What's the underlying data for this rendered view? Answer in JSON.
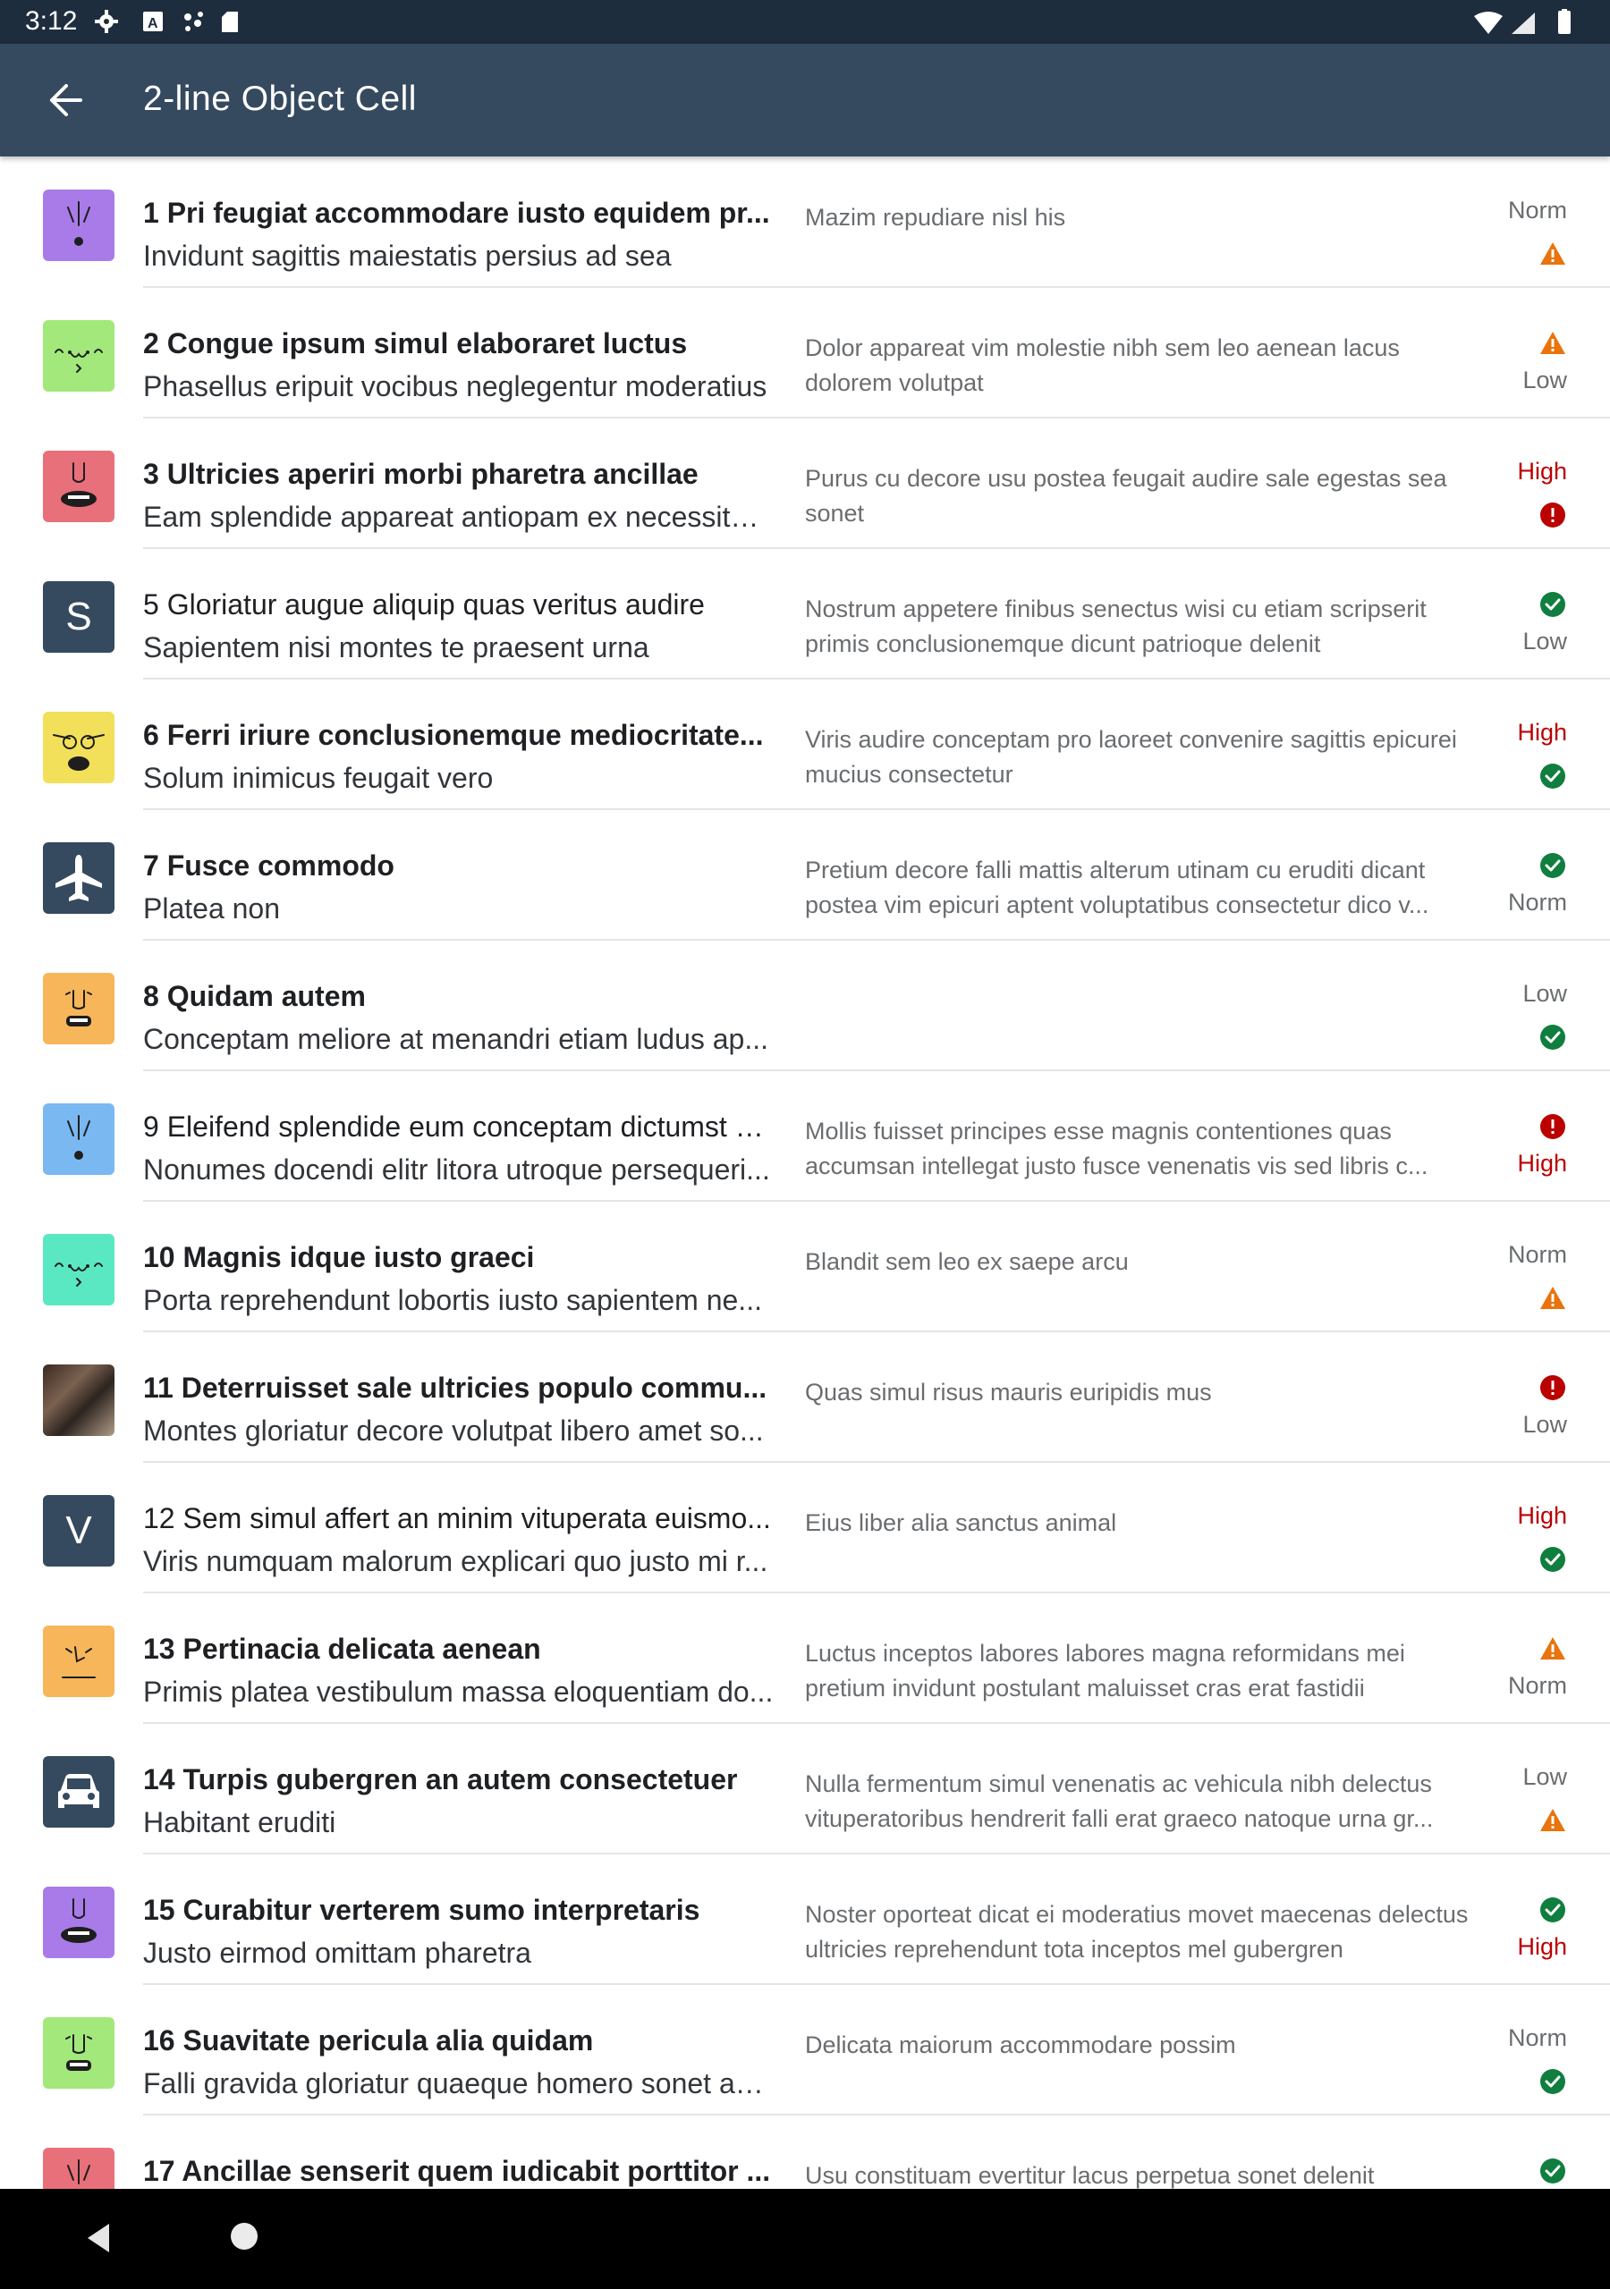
{
  "status_bar": {
    "time": "3:12",
    "left_icons": [
      "gear-icon",
      "a-icon",
      "bubbles-icon",
      "sd-card-icon"
    ],
    "right_icons": [
      "wifi-icon",
      "signal-icon",
      "battery-icon"
    ]
  },
  "app_bar": {
    "title": "2-line Object Cell",
    "back_icon": "arrow-left-icon"
  },
  "colors": {
    "app_bar": "#354a5f",
    "status_bar": "#1d2d3e",
    "warning": "#e9730c",
    "error": "#bb0000",
    "success": "#107e3e",
    "neutral_text": "#6a6d70"
  },
  "items": [
    {
      "title": "1 Pri feugiat accommodare iusto equidem pr...",
      "subtitle": "Invidunt sagittis maiestatis persius ad sea",
      "description": "Mazim repudiare nisl his",
      "status_text": "Norm",
      "status_icon": "warning",
      "order": "text-first",
      "bold": true,
      "avatar": {
        "type": "face",
        "bg": "#a97be8",
        "face": "exclaim"
      }
    },
    {
      "title": "2 Congue ipsum simul elaboraret luctus",
      "subtitle": "Phasellus eripuit vocibus neglegentur moderatius",
      "description": "Dolor appareat vim molestie nibh sem leo aenean lacus dolorem volutpat",
      "status_text": "Low",
      "status_icon": "warning",
      "order": "icon-first",
      "bold": true,
      "avatar": {
        "type": "face",
        "bg": "#a2e87a",
        "face": "cat"
      }
    },
    {
      "title": "3 Ultricies aperiri morbi pharetra ancillae",
      "subtitle": "Eam splendide appareat antiopam ex necessitat...",
      "description": "Purus cu decore usu postea feugait audire sale egestas sea sonet",
      "status_text": "High",
      "status_icon": "error",
      "order": "text-first",
      "bold": true,
      "avatar": {
        "type": "face",
        "bg": "#e8707a",
        "face": "grin"
      }
    },
    {
      "title": "5 Gloriatur augue aliquip quas veritus audire",
      "subtitle": "Sapientem nisi montes te praesent urna",
      "description": "Nostrum appetere finibus senectus wisi cu etiam scripserit primis conclusionemque dicunt patrioque delenit",
      "status_text": "Low",
      "status_icon": "success",
      "order": "icon-first",
      "bold": false,
      "avatar": {
        "type": "letter",
        "letter": "S"
      }
    },
    {
      "title": "6 Ferri iriure conclusionemque mediocritate...",
      "subtitle": "Solum inimicus feugait vero",
      "description": "Viris audire conceptam pro laoreet convenire sagittis epicurei mucius consectetur",
      "status_text": "High",
      "status_icon": "success",
      "order": "text-first",
      "bold": true,
      "avatar": {
        "type": "face",
        "bg": "#f2e05a",
        "face": "glasses"
      }
    },
    {
      "title": "7 Fusce commodo",
      "subtitle": "Platea non",
      "description": "Pretium decore falli mattis alterum utinam cu eruditi dicant postea vim epicuri aptent voluptatibus consectetur dico v...",
      "status_text": "Norm",
      "status_icon": "success",
      "order": "icon-first",
      "bold": true,
      "avatar": {
        "type": "glyph",
        "glyph": "airplane"
      }
    },
    {
      "title": "8 Quidam autem",
      "subtitle": "Conceptam meliore at menandri etiam ludus ap...",
      "description": "",
      "status_text": "Low",
      "status_icon": "success",
      "order": "text-first",
      "bold": true,
      "avatar": {
        "type": "face",
        "bg": "#f7b65a",
        "face": "teeth"
      }
    },
    {
      "title": "9 Eleifend splendide eum conceptam dictumst e...",
      "subtitle": "Nonumes docendi elitr litora utroque persequeri...",
      "description": "Mollis fuisset principes esse magnis contentiones quas accumsan intellegat justo fusce venenatis vis sed libris c...",
      "status_text": "High",
      "status_icon": "error",
      "order": "icon-first",
      "bold": false,
      "avatar": {
        "type": "face",
        "bg": "#7ab8f2",
        "face": "exclaim"
      }
    },
    {
      "title": "10 Magnis idque iusto graeci",
      "subtitle": "Porta reprehendunt lobortis iusto sapientem ne...",
      "description": "Blandit sem leo ex saepe arcu",
      "status_text": "Norm",
      "status_icon": "warning",
      "order": "text-first",
      "bold": true,
      "avatar": {
        "type": "face",
        "bg": "#5ae8c2",
        "face": "cat"
      }
    },
    {
      "title": "11 Deterruisset sale ultricies populo commu...",
      "subtitle": "Montes gloriatur decore volutpat libero amet so...",
      "description": "Quas simul risus mauris euripidis mus",
      "status_text": "Low",
      "status_icon": "error",
      "order": "icon-first",
      "bold": true,
      "avatar": {
        "type": "photo"
      }
    },
    {
      "title": "12 Sem simul affert an minim vituperata euismo...",
      "subtitle": "Viris numquam malorum explicari quo justo mi r...",
      "description": "Eius liber alia sanctus animal",
      "status_text": "High",
      "status_icon": "success",
      "order": "text-first",
      "bold": false,
      "avatar": {
        "type": "letter",
        "letter": "V"
      }
    },
    {
      "title": "13 Pertinacia delicata aenean",
      "subtitle": "Primis platea vestibulum massa eloquentiam do...",
      "description": "Luctus inceptos labores labores magna reformidans mei pretium invidunt postulant maluisset cras erat fastidii",
      "status_text": "Norm",
      "status_icon": "warning",
      "order": "icon-first",
      "bold": true,
      "avatar": {
        "type": "face",
        "bg": "#f7b65a",
        "face": "flat"
      }
    },
    {
      "title": "14 Turpis gubergren an autem consectetuer",
      "subtitle": "Habitant eruditi",
      "description": "Nulla fermentum simul venenatis ac vehicula nibh delectus vituperatoribus hendrerit falli erat graeco natoque urna gr...",
      "status_text": "Low",
      "status_icon": "warning",
      "order": "text-first",
      "bold": true,
      "avatar": {
        "type": "glyph",
        "glyph": "car"
      }
    },
    {
      "title": "15 Curabitur verterem sumo interpretaris",
      "subtitle": "Justo eirmod omittam pharetra",
      "description": "Noster oporteat dicat ei moderatius movet maecenas delectus ultricies reprehendunt tota inceptos mel gubergren",
      "status_text": "High",
      "status_icon": "success",
      "order": "icon-first",
      "bold": true,
      "avatar": {
        "type": "face",
        "bg": "#a97be8",
        "face": "grin"
      }
    },
    {
      "title": "16 Suavitate pericula alia quidam",
      "subtitle": "Falli gravida gloriatur quaeque homero sonet au...",
      "description": "Delicata maiorum accommodare possim",
      "status_text": "Norm",
      "status_icon": "success",
      "order": "text-first",
      "bold": true,
      "avatar": {
        "type": "face",
        "bg": "#a2e87a",
        "face": "teeth"
      }
    },
    {
      "title": "17 Ancillae senserit quem iudicabit porttitor ...",
      "subtitle": "",
      "description": "Usu constituam evertitur lacus perpetua sonet delenit",
      "status_text": "",
      "status_icon": "success",
      "order": "icon-first",
      "bold": true,
      "avatar": {
        "type": "face",
        "bg": "#e8707a",
        "face": "exclaim"
      }
    }
  ],
  "nav_bar": {
    "back_icon": "nav-back-triangle-icon",
    "home_icon": "nav-home-circle-icon"
  }
}
